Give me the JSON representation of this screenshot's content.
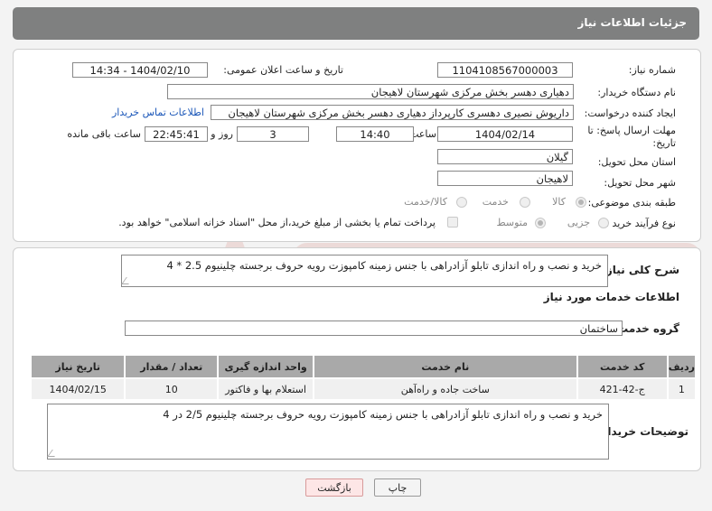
{
  "header": {
    "title": "جزئیات اطلاعات نیاز"
  },
  "form": {
    "need_number_label": "شماره نیاز:",
    "need_number": "1104108567000003",
    "announce_label": "تاریخ و ساعت اعلان عمومی:",
    "announce_value": "1404/02/10 - 14:34",
    "buyer_org_label": "نام دستگاه خریدار:",
    "buyer_org": "دهیاری دهسر بخش مرکزی شهرستان لاهیجان",
    "creator_label": "ایجاد کننده درخواست:",
    "creator": "داریوش نصیری دهسری کارپرداز دهیاری دهسر بخش مرکزی شهرستان لاهیجان",
    "contact_link": "اطلاعات تماس خریدار",
    "deadline_label_1": "مهلت ارسال پاسخ: تا",
    "deadline_label_2": "تاریخ:",
    "deadline_date": "1404/02/14",
    "time_label": "ساعت",
    "deadline_time": "14:40",
    "days_value": "3",
    "days_label": "روز و",
    "remaining_time": "22:45:41",
    "remaining_label": "ساعت باقی مانده",
    "province_label": "استان محل تحویل:",
    "province": "گیلان",
    "city_label": "شهر محل تحویل:",
    "city": "لاهیجان",
    "category_label": "طبقه بندی موضوعی:",
    "category_options": [
      "کالا",
      "خدمت",
      "کالا/خدمت"
    ],
    "process_label": "نوع فرآیند خرید :",
    "process_options": [
      "جزیی",
      "متوسط"
    ],
    "payment_note": "پرداخت تمام یا بخشی از مبلغ خرید،از محل \"اسناد خزانه اسلامی\" خواهد بود."
  },
  "summary": {
    "label": "شرح کلی نیاز:",
    "text": "خرید و نصب و راه اندازی تابلو آزادراهی با جنس زمینه کامپوزت رویه حروف برجسته چلینیوم 2.5 * 4"
  },
  "services": {
    "section_title": "اطلاعات خدمات مورد نیاز",
    "group_label": "گروه خدمت:",
    "group_value": "ساختمان",
    "columns": [
      "ردیف",
      "کد خدمت",
      "نام خدمت",
      "واحد اندازه گیری",
      "تعداد / مقدار",
      "تاریخ نیاز"
    ],
    "rows": [
      {
        "row": "1",
        "code": "ج-42-421",
        "name": "ساخت جاده و راه‌آهن",
        "unit": "استعلام بها و فاکتور",
        "qty": "10",
        "date": "1404/02/15"
      }
    ]
  },
  "buyer_notes": {
    "label": "توضیحات خریدار:",
    "text": "خرید و نصب و راه اندازی تابلو آزادراهی با جنس زمینه کامپوزت رویه حروف برجسته چلینیوم 2/5 در 4"
  },
  "buttons": {
    "print": "چاپ",
    "back": "بازگشت"
  },
  "colors": {
    "header_bg": "#7f8080",
    "link": "#1a56b8",
    "back_button_bg": "#fde6e6",
    "watermark": "#c0392b"
  }
}
